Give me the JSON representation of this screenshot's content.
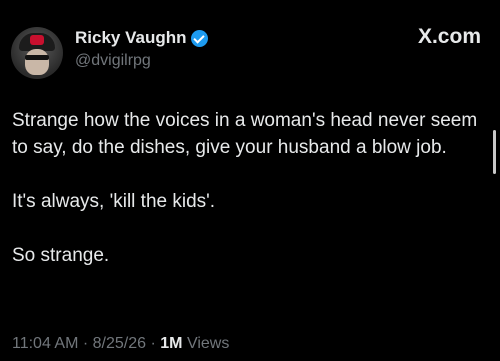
{
  "author": {
    "name": "Ricky Vaughn",
    "handle": "@dvigilrpg",
    "verified_icon": "verified-badge-icon",
    "verified_color": "#1d9bf0"
  },
  "brand": {
    "label": "X.com"
  },
  "tweet": {
    "line1": "Strange how the voices in a woman's head never seem to say, do the dishes, give your husband a blow job.",
    "line2": "It's always, 'kill the kids'.",
    "line3": "So strange."
  },
  "meta": {
    "time": "11:04 AM",
    "date": "8/25/26",
    "separator": "·",
    "views_count": "1M",
    "views_label": "Views"
  },
  "colors": {
    "background": "#000000",
    "text": "#e7e9ea",
    "secondary": "#71767b"
  }
}
